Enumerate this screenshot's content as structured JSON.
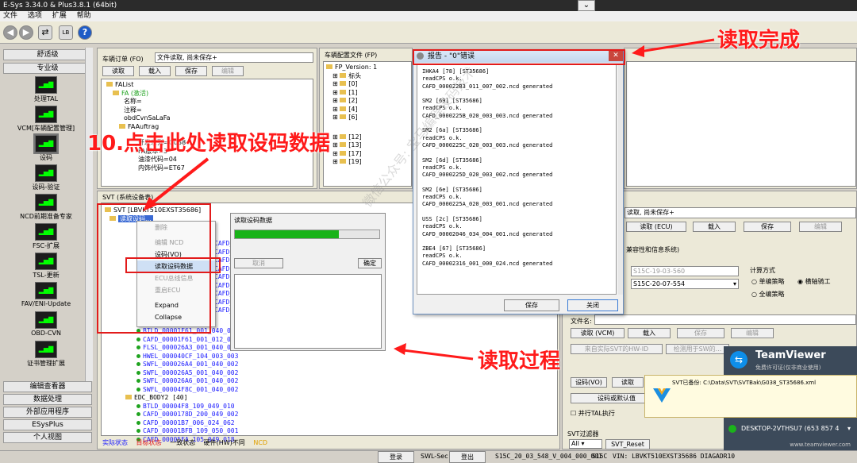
{
  "window": {
    "title": "E-Sys 3.34.0 & Plus3.8.1 (64bit)"
  },
  "menu": [
    "文件",
    "选项",
    "扩展",
    "帮助"
  ],
  "toolbar": {
    "help": "?",
    "lb": "LB"
  },
  "nav": {
    "sections": [
      "舒适级",
      "专业级"
    ],
    "items": [
      {
        "icon": "处理TAL",
        "label": "处理TAL"
      },
      {
        "icon": "VCM",
        "label": "VCM[车辆配置管理]"
      },
      {
        "icon": "设码",
        "label": "设码"
      },
      {
        "icon": "验证",
        "label": "设码-验证"
      },
      {
        "icon": "NCD",
        "label": "NCD前期准备专家"
      },
      {
        "icon": "FSC",
        "label": "FSC-扩展"
      },
      {
        "icon": "TSL",
        "label": "TSL-更新"
      },
      {
        "icon": "FAV",
        "label": "FAV/ENI-Update"
      },
      {
        "icon": "OBD",
        "label": "OBD-CVN"
      },
      {
        "icon": "证书",
        "label": "证书管理扩展"
      }
    ],
    "bottom": [
      "编辑查看器",
      "数据处理",
      "外部应用程序",
      "ESysPlus",
      "个人视图"
    ]
  },
  "fa_panel": {
    "title": "车辆订单 (FO)",
    "status": "文件读取, 尚未保存+",
    "buttons": [
      "读取",
      "载入",
      "保存",
      "编辑"
    ],
    "tree": [
      "FAList",
      "FA (激活)",
      "名称=",
      "注释=",
      "obdCvnSaLaFa",
      "FAAuftrag",
      "开发系列=G038",
      "FA版本=3",
      "油漆代码=04",
      "内饰代码=ET67"
    ]
  },
  "fp_panel": {
    "title": "车辆配置文件 (FP)",
    "tree": [
      "FP_Version: 1",
      "标头",
      "[0]",
      "[1]",
      "[2]",
      "[4]",
      "[6]",
      "[12]",
      "[13]",
      "[17]",
      "[19]"
    ]
  },
  "svt_panel": {
    "title": "SVT (系统设备表)",
    "root": "SVT [LBVKT510EXST35686]",
    "node": "读取设码...",
    "items": [
      "CAFD_0000..._001_040_000",
      "CAFD_0000..._001_065",
      "CAFD_0000..._001_002",
      "CAFD_0000..._001_012",
      "CAFD_0000..._001_024",
      "CAFD_0000..._001_050",
      "CAFD_0000..._001_003",
      "CAFD_0000..._001_001",
      "CAFD_0000..._001_000"
    ],
    "items_after": [
      "BTLD_00001F61_001_040_002",
      "CAFD_00001F61_001_012_002",
      "FLSL_000026A3_001_040_002",
      "HWEL_000040CF_104_003_003",
      "SWFL_000026A4_001_040_002",
      "SWFL_000026A5_001_040_002",
      "SWFL_000026A6_001_040_002",
      "SWFL_00004F8C_001_040_002"
    ],
    "group2": "EDC_BODY2 [40]",
    "group2_items": [
      "BTLD_00004F8_109_049_010",
      "CAFD_0000178D_200_049_002",
      "CAFD_00001B7_006_024_062",
      "CAFD_00001BFB_109_050_001",
      "CAFD_00005FA_105_049_018"
    ],
    "legend": [
      "实际状态",
      "目标状态",
      "一致状态",
      "硬件(HW)不同",
      "NCD"
    ]
  },
  "context_menu": {
    "items": [
      "删除",
      "编辑 NCD",
      "设码(VO)",
      "读取设码数据",
      "ECU总线信息",
      "重启ECU",
      "Expand",
      "Collapse"
    ]
  },
  "progress_dialog": {
    "title": "读取设码数据",
    "progress_pct": 72,
    "cancel": "取消",
    "ok": "确定"
  },
  "report": {
    "title": "报告 - \"0\"错误",
    "lines": [
      "IHKA4 [78] [ST35686]",
      "readCPS o.k.",
      "CAFD_000022B3_011_007_002.ncd generated",
      "",
      "SM2 [69] [ST35686]",
      "readCPS o.k.",
      "CAFD_0000225B_020_003_003.ncd generated",
      "",
      "SM2 [6a] [ST35686]",
      "readCPS o.k.",
      "CAFD_0000225C_020_003_003.ncd generated",
      "",
      "SM2 [6d] [ST35686]",
      "readCPS o.k.",
      "CAFD_0000225D_020_003_002.ncd generated",
      "",
      "SM2 [6e] [ST35686]",
      "readCPS o.k.",
      "CAFD_0000225A_020_003_001.ncd generated",
      "",
      "USS [2c] [ST35686]",
      "readCPS o.k.",
      "CAFD_00002046_034_004_001.ncd generated",
      "",
      "ZBE4 [67] [ST35686]",
      "readCPS o.k.",
      "CAFD_00002316_001_000_024.ncd generated"
    ],
    "save": "保存",
    "close": "关闭"
  },
  "right_panel": {
    "status": "读取, 尚未保存+",
    "buttons1": [
      "读取 (ECU)",
      "载入",
      "保存",
      "编辑"
    ],
    "section": "兼容性和信息系统)",
    "select1": "S15C-19-03-560",
    "select2": "S15C-20-07-554",
    "calc_title": "计算方式",
    "radio": [
      "单编策略",
      "横轴骑工",
      "全编策略"
    ],
    "file_label": "文件名:",
    "buttons2": [
      "读取 (VCM)",
      "载入",
      "保存",
      "编辑"
    ],
    "hwid": "来自实际SVT的HW-ID",
    "check_hw": "检测用于SW的...",
    "code_btns": [
      "设码(VO)",
      "读取"
    ],
    "code_default": "设码或默认值",
    "parallel": "并行TAL执行",
    "svt_filter": "SVT过滤器",
    "filter_all": "All",
    "svt_reset": "SVT_Reset"
  },
  "teamviewer": {
    "brand": "TeamViewer",
    "sub": "免费许可证(仅非商业使用)",
    "notice": "SVT已备份: C:\\Data\\SVT\\SVTBak\\G038_ST35686.xml",
    "host": "DESKTOP-2VTHSU7 (653 857 4",
    "url": "www.teamviewer.com"
  },
  "statusbar": {
    "login": "登录",
    "swl": "SWL-Sec",
    "logout": "登出",
    "version": "S15C_20_03_548_V_004_000_001",
    "series": "S15C",
    "vin": "VIN: LBVKT510EXST35686 DIAGADR10"
  },
  "annotations": {
    "done": "读取完成",
    "step10": "10.点击此处读取设码数据",
    "process": "读取过程"
  },
  "watermark": "微信公众号: 宝马编程设码技术"
}
